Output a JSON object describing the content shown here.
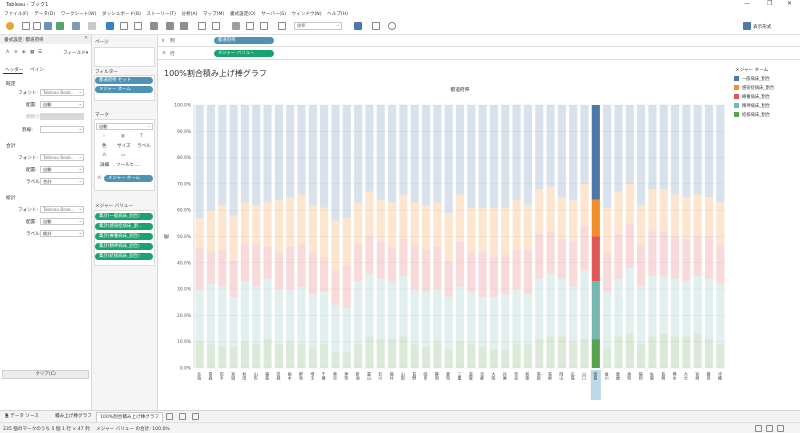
{
  "app": {
    "title": "Tableau - ブック1",
    "min": "—",
    "max": "❐",
    "close": "✕"
  },
  "menu": [
    "ファイル(F)",
    "データ(D)",
    "ワークシート(W)",
    "ダッシュボード(B)",
    "ストーリー(T)",
    "分析(A)",
    "マップ(M)",
    "書式設定(O)",
    "サーバー(S)",
    "ウィンドウ(N)",
    "ヘルプ(H)"
  ],
  "toolbar": {
    "fit": "標準",
    "show_me": "表示形式"
  },
  "format_pane": {
    "title": "書式設定: 都道府県",
    "fields_label": "フィールド▾",
    "tab_header": "ヘッダー",
    "tab_pane": "ペイン",
    "default_section": "既定",
    "font_label": "フォント:",
    "font_value": "Tableau Book...",
    "align_label": "配置:",
    "align_value": "自動",
    "shading_label": "網掛け:",
    "border_label": "罫線:",
    "total_section": "合計",
    "total_font_label": "フォント:",
    "total_font_value": "Tableau Book...",
    "total_align_label": "配置:",
    "total_align_value": "自動",
    "total_label_label": "ラベル:",
    "total_label_value": "合計",
    "grand_section": "総計",
    "grand_font_label": "フォント:",
    "grand_font_value": "Tableau Book...",
    "grand_align_label": "配置:",
    "grand_align_value": "自動",
    "grand_label_label": "ラベル:",
    "grand_label_value": "総計",
    "clear_button": "クリア(C)"
  },
  "cards": {
    "pages": "ページ",
    "filters": "フィルター",
    "filter_items": [
      "都道府県 セット",
      "メジャー ネーム"
    ],
    "marks": "マーク",
    "mark_type": "自動",
    "mark_buttons": [
      "色",
      "サイズ",
      "ラベル",
      "詳細",
      "ツールヒ...."
    ],
    "mark_pill": "メジャー ネーム",
    "measure_values": "メジャー バリュー",
    "measure_items": [
      "集計(一般病床_割合)",
      "集計(感染症病床_割...",
      "集計(療養病床_割合)",
      "集計(精神病床_割合)",
      "集計(結核病床_割合)"
    ]
  },
  "shelves": {
    "columns_label": "列",
    "columns_pill": "都道府県",
    "rows_label": "行",
    "rows_pill": "メジャー バリュー"
  },
  "viz": {
    "title": "100%割合積み上げ棒グラフ",
    "header": "都道府県",
    "ylabel": "値"
  },
  "legend": {
    "title": "メジャー ネーム",
    "items": [
      {
        "label": "一般病床_割合",
        "color": "#4e79a7"
      },
      {
        "label": "感染症病床_割合",
        "color": "#f28e2b"
      },
      {
        "label": "療養病床_割合",
        "color": "#e15759"
      },
      {
        "label": "精神病床_割合",
        "color": "#76b7b2"
      },
      {
        "label": "結核病床_割合",
        "color": "#59a14f"
      }
    ]
  },
  "tabs": {
    "data_source": "データ ソース",
    "sheet1": "積み上げ棒グラフ",
    "sheet2": "100%割合積み上げ棒グラフ"
  },
  "status": {
    "marks": "235 個のマークのうち 5 個",
    "rows": "1 行 × 47 列",
    "sum": "メジャー バリュー の合計: 100.0%"
  },
  "chart_data": {
    "type": "bar",
    "stacked": true,
    "percent": true,
    "ylim": [
      0,
      100
    ],
    "yticks": [
      "0.0%",
      "10.0%",
      "20.0%",
      "30.0%",
      "40.0%",
      "50.0%",
      "60.0%",
      "70.0%",
      "80.0%",
      "90.0%",
      "100.0%"
    ],
    "highlighted_index": 35,
    "series_order": [
      "結核病床_割合",
      "精神病床_割合",
      "療養病床_割合",
      "感染症病床_割合",
      "一般病床_割合"
    ],
    "categories": [
      "北海",
      "青森",
      "岩手",
      "宮城",
      "秋田",
      "山形",
      "福島",
      "茨城",
      "栃木",
      "群馬",
      "埼玉",
      "千葉",
      "東京",
      "神奈",
      "新潟",
      "富山",
      "石川",
      "福井",
      "山梨",
      "長野",
      "岐阜",
      "静岡",
      "愛知",
      "三重",
      "滋賀",
      "京都",
      "大阪",
      "兵庫",
      "奈良",
      "和歌",
      "鳥取",
      "島根",
      "岡山",
      "広島",
      "山口",
      "徳島",
      "香川",
      "愛媛",
      "高知",
      "福岡",
      "佐賀",
      "長崎",
      "熊本",
      "大分",
      "宮崎",
      "鹿児",
      "沖縄"
    ],
    "boundaries": [
      [
        10,
        30,
        46,
        57,
        100
      ],
      [
        9,
        32,
        44,
        60,
        100
      ],
      [
        8,
        31,
        45,
        62,
        100
      ],
      [
        8,
        27,
        41,
        58,
        100
      ],
      [
        10,
        33,
        47,
        63,
        100
      ],
      [
        9,
        31,
        47,
        62,
        100
      ],
      [
        11,
        34,
        46,
        63,
        100
      ],
      [
        9,
        30,
        44,
        64,
        100
      ],
      [
        10,
        30,
        46,
        65,
        100
      ],
      [
        9,
        31,
        47,
        66,
        100
      ],
      [
        8,
        28,
        44,
        62,
        100
      ],
      [
        9,
        29,
        42,
        61,
        100
      ],
      [
        6,
        24,
        37,
        56,
        100
      ],
      [
        6,
        23,
        39,
        57,
        100
      ],
      [
        9,
        33,
        47,
        63,
        100
      ],
      [
        12,
        36,
        50,
        67,
        100
      ],
      [
        11,
        34,
        48,
        64,
        100
      ],
      [
        11,
        33,
        46,
        63,
        100
      ],
      [
        12,
        35,
        49,
        66,
        100
      ],
      [
        9,
        30,
        47,
        63,
        100
      ],
      [
        8,
        29,
        45,
        62,
        100
      ],
      [
        10,
        30,
        46,
        63,
        100
      ],
      [
        7,
        27,
        41,
        59,
        100
      ],
      [
        10,
        31,
        48,
        66,
        100
      ],
      [
        9,
        29,
        44,
        61,
        100
      ],
      [
        8,
        27,
        44,
        61,
        100
      ],
      [
        7,
        27,
        42,
        61,
        100
      ],
      [
        7,
        28,
        43,
        61,
        100
      ],
      [
        9,
        30,
        45,
        64,
        100
      ],
      [
        9,
        28,
        45,
        62,
        100
      ],
      [
        11,
        34,
        51,
        68,
        100
      ],
      [
        12,
        36,
        52,
        69,
        100
      ],
      [
        12,
        34,
        49,
        65,
        100
      ],
      [
        10,
        31,
        48,
        64,
        100
      ],
      [
        11,
        37,
        54,
        70,
        100
      ],
      [
        11,
        33,
        50,
        64,
        100
      ],
      [
        8,
        29,
        44,
        61,
        100
      ],
      [
        12,
        34,
        51,
        67,
        100
      ],
      [
        13,
        38,
        55,
        70,
        100
      ],
      [
        9,
        31,
        47,
        62,
        100
      ],
      [
        12,
        35,
        52,
        68,
        100
      ],
      [
        13,
        35,
        52,
        68,
        100
      ],
      [
        12,
        34,
        50,
        66,
        100
      ],
      [
        12,
        33,
        49,
        65,
        100
      ],
      [
        13,
        35,
        50,
        66,
        100
      ],
      [
        11,
        34,
        50,
        65,
        100
      ],
      [
        9,
        32,
        47,
        63,
        100
      ]
    ]
  }
}
